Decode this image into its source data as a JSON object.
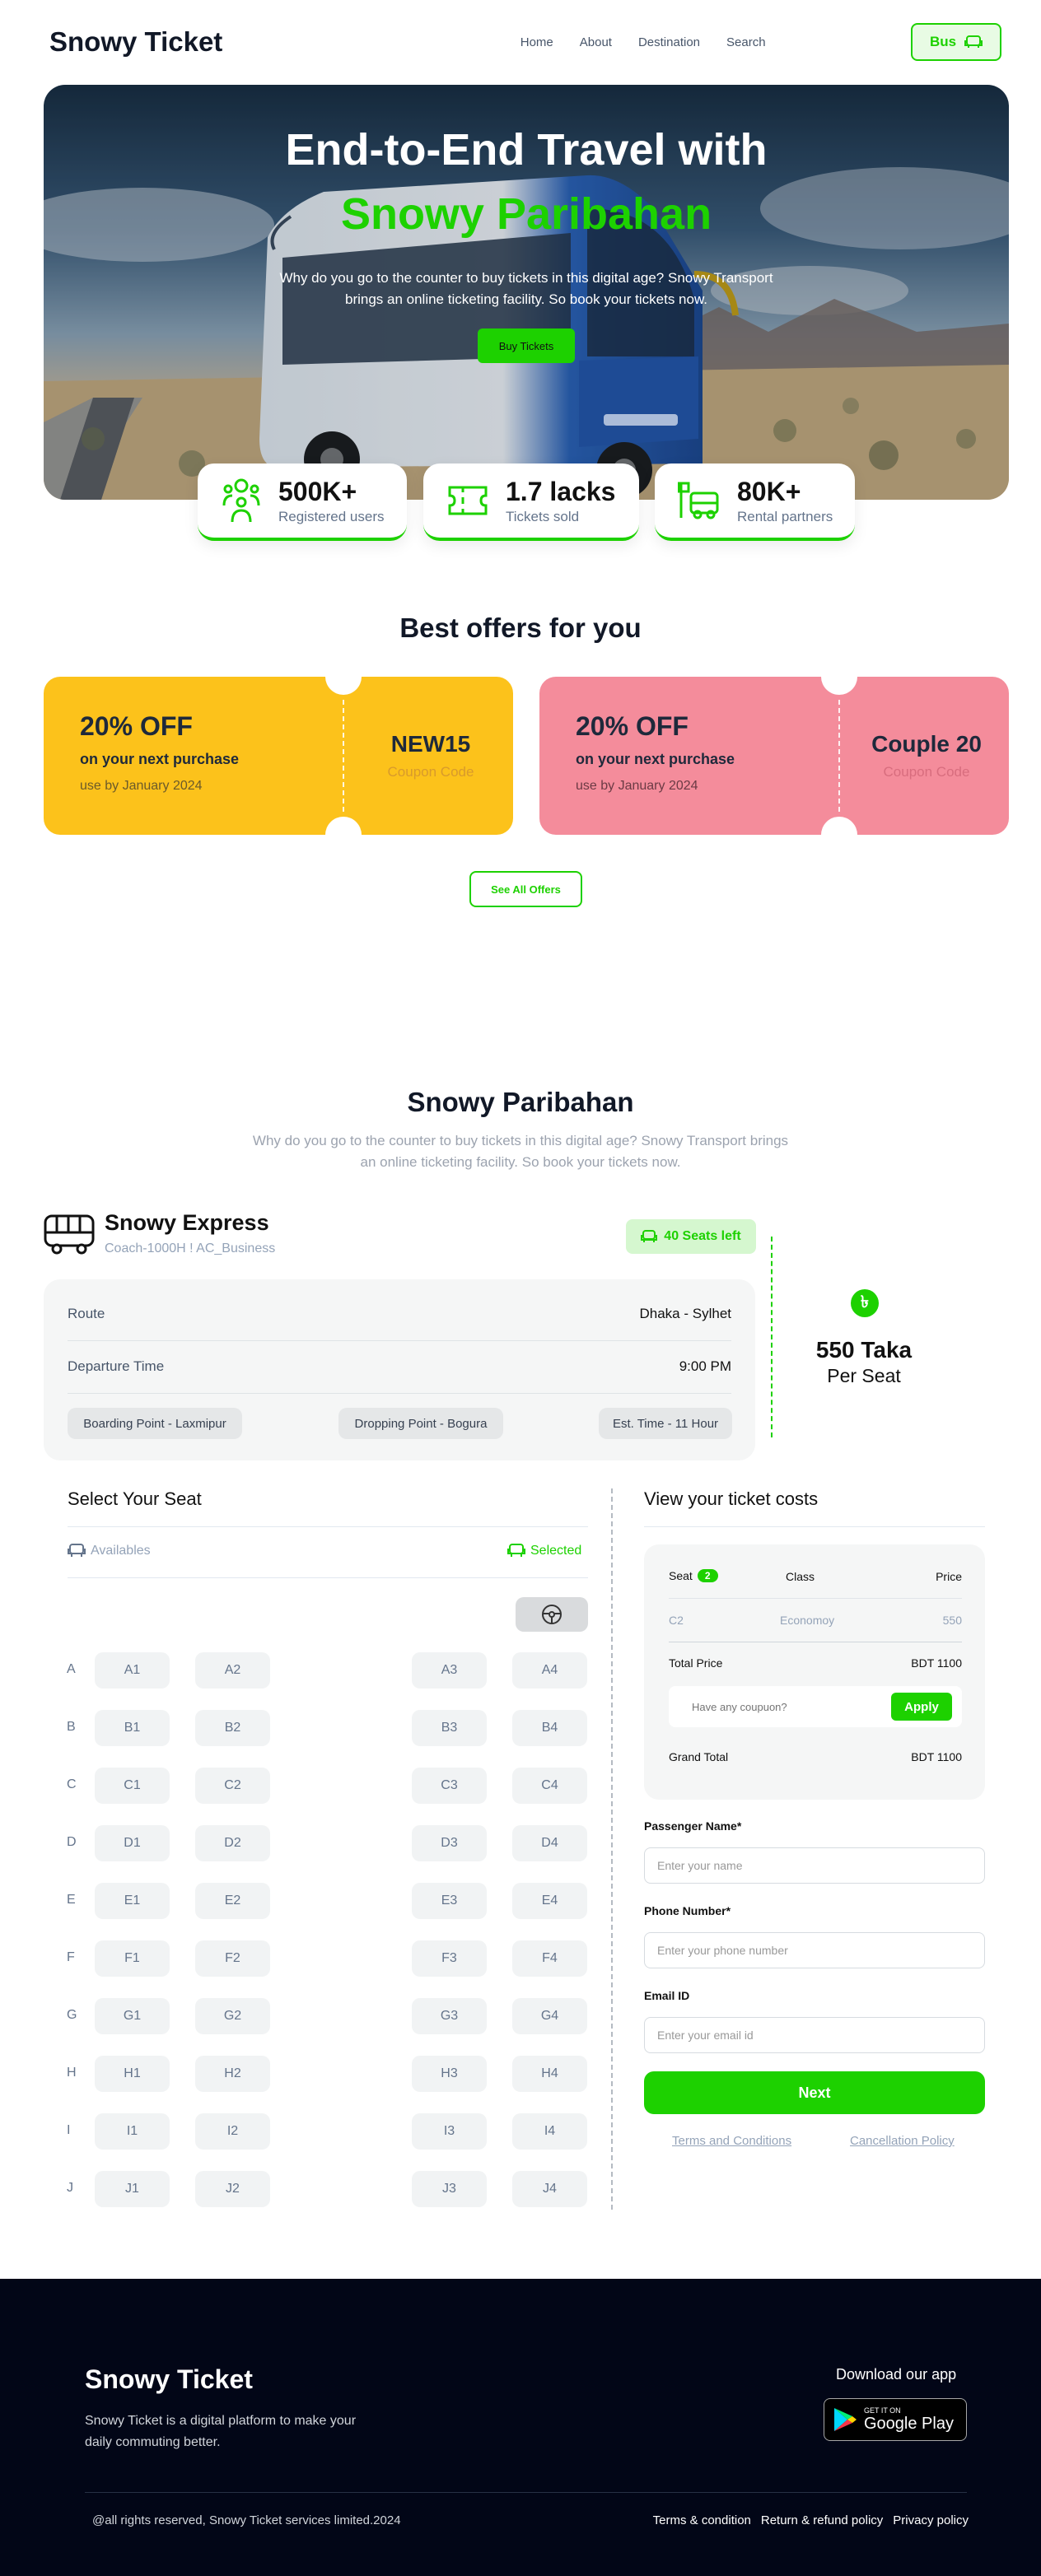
{
  "navbar": {
    "logo": "Snowy Ticket",
    "links": [
      "Home",
      "About",
      "Destination",
      "Search"
    ],
    "bus_button": "Bus"
  },
  "hero": {
    "title_line1": "End-to-End Travel with",
    "title_line2": "Snowy Paribahan",
    "description": "Why do you go to the counter to buy tickets in this digital age? Snowy Transport brings an online ticketing facility. So book your tickets now.",
    "button": "Buy Tickets"
  },
  "stats": [
    {
      "value": "500K+",
      "label": "Registered users",
      "icon": "users-icon"
    },
    {
      "value": "1.7 lacks",
      "label": "Tickets sold",
      "icon": "ticket-icon"
    },
    {
      "value": "80K+",
      "label": "Rental partners",
      "icon": "bus-stop-icon"
    }
  ],
  "offers": {
    "title": "Best offers for you",
    "items": [
      {
        "discount": "20% OFF",
        "line1": "on your next purchase",
        "line2": "use by January 2024",
        "code": "NEW15",
        "code_label": "Coupon Code",
        "color": "#fcc21b"
      },
      {
        "discount": "20% OFF",
        "line1": "on your next purchase",
        "line2": "use by January 2024",
        "code": "Couple 20",
        "code_label": "Coupon Code",
        "color": "#f48c9b"
      }
    ],
    "see_all": "See All Offers"
  },
  "paribahan": {
    "title": "Snowy Paribahan",
    "description": "Why do you go to the counter to buy tickets in this digital age? Snowy Transport brings an online ticketing facility. So book your tickets now."
  },
  "express": {
    "name": "Snowy Express",
    "code": "Coach-1000H ! AC_Business",
    "seats_left": "40 Seats left",
    "route_label": "Route",
    "route_value": "Dhaka - Sylhet",
    "departure_label": "Departure Time",
    "departure_value": "9:00 PM",
    "boarding": "Boarding Point - Laxmipur",
    "dropping": "Dropping Point - Bogura",
    "est_time": "Est. Time - 11 Hour",
    "price": "550 Taka",
    "price_unit": "Per Seat",
    "taka_symbol": "৳"
  },
  "seat_select": {
    "title": "Select Your Seat",
    "available_label": "Availables",
    "selected_label": "Selected",
    "rows": [
      "A",
      "B",
      "C",
      "D",
      "E",
      "F",
      "G",
      "H",
      "I",
      "J"
    ]
  },
  "costs": {
    "title": "View your ticket costs",
    "seat_header": "Seat",
    "seat_count": "2",
    "class_header": "Class",
    "price_header": "Price",
    "item_seat": "C2",
    "item_class": "Economoy",
    "item_price": "550",
    "total_label": "Total Price",
    "total_value": "BDT 1100",
    "coupon_placeholder": "Have any coupuon?",
    "apply": "Apply",
    "grand_label": "Grand Total",
    "grand_value": "BDT 1100"
  },
  "form": {
    "name_label": "Passenger Name*",
    "name_placeholder": "Enter your name",
    "phone_label": "Phone Number*",
    "phone_placeholder": "Enter your phone number",
    "email_label": "Email ID",
    "email_placeholder": "Enter your email id",
    "next": "Next",
    "terms": "Terms and Conditions",
    "cancellation": "Cancellation Policy"
  },
  "footer": {
    "logo": "Snowy Ticket",
    "tagline": "Snowy Ticket is a digital platform to make your daily commuting better.",
    "download": "Download our app",
    "get_it_on": "GET IT ON",
    "store": "Google Play",
    "copyright": "@all rights reserved, Snowy Ticket services limited.2024",
    "links": [
      "Terms & condition",
      "Return & refund policy",
      "Privacy policy"
    ]
  },
  "colors": {
    "accent": "#1dd100",
    "dark": "#020617"
  }
}
